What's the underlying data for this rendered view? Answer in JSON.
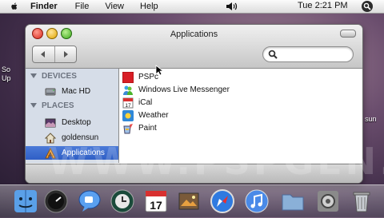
{
  "menubar": {
    "app_name": "Finder",
    "items": [
      "File",
      "View",
      "Help"
    ],
    "clock": "Tue 2:21 PM"
  },
  "window": {
    "title": "Applications",
    "search": {
      "value": "",
      "placeholder": ""
    }
  },
  "sidebar": {
    "devices_label": "DEVICES",
    "places_label": "PLACES",
    "devices": [
      {
        "label": "Mac HD",
        "icon": "hard-drive-icon"
      }
    ],
    "places": [
      {
        "label": "Desktop",
        "icon": "desktop-icon"
      },
      {
        "label": "goldensun",
        "icon": "home-icon"
      },
      {
        "label": "Applications",
        "icon": "applications-icon",
        "selected": true
      }
    ]
  },
  "files": [
    {
      "label": "PSPc",
      "icon": "pspc-app-icon"
    },
    {
      "label": "Windows Live Messenger",
      "icon": "messenger-icon"
    },
    {
      "label": "iCal",
      "icon": "ical-icon"
    },
    {
      "label": "Weather",
      "icon": "weather-icon"
    },
    {
      "label": "Paint",
      "icon": "paint-icon"
    }
  ],
  "desktop_labels": [
    "So",
    "Up",
    "sun"
  ],
  "dock": {
    "items": [
      "finder-icon",
      "dashboard-icon",
      "ichat-icon",
      "time-machine-icon",
      "ical-dock-icon",
      "iphoto-icon",
      "safari-icon",
      "itunes-icon",
      "folder-icon",
      "system-preferences-icon",
      "trash-icon"
    ],
    "ical_day": "17"
  },
  "watermark": "WWW.PSPGEN.COM",
  "colors": {
    "selection": "#3a68cc",
    "sidebar_bg": "#d6dde8"
  }
}
